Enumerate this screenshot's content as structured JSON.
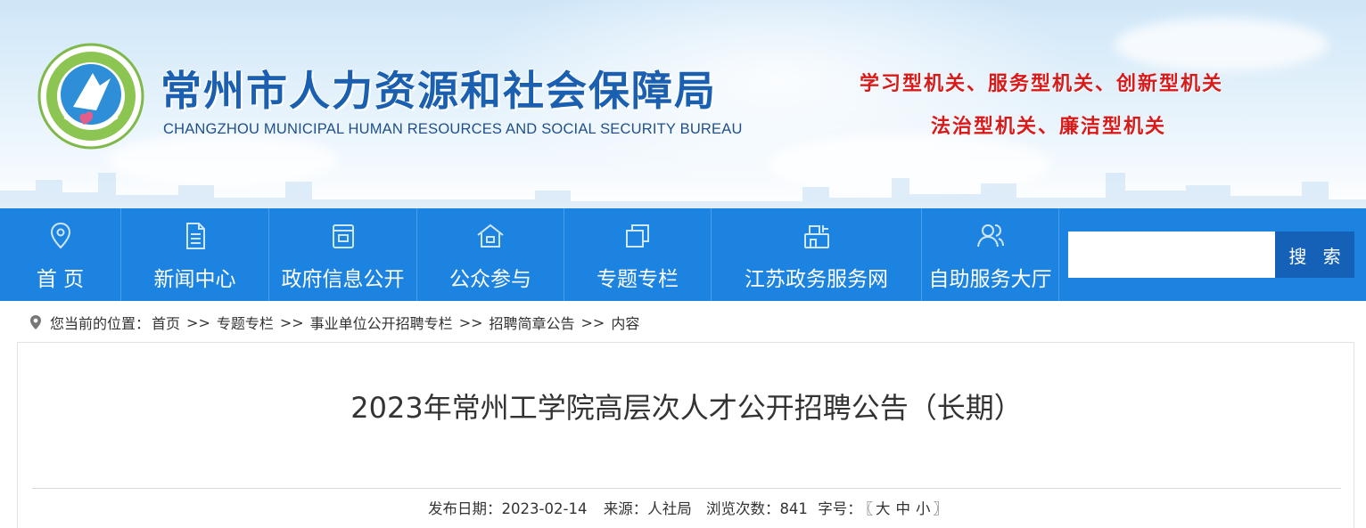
{
  "header": {
    "title": "常州市人力资源和社会保障局",
    "subtitle": "CHANGZHOU MUNICIPAL HUMAN RESOURCES AND SOCIAL SECURITY BUREAU",
    "slogan_line1": "学习型机关、服务型机关、创新型机关",
    "slogan_line2": "法治型机关、廉洁型机关",
    "logo_icon": "bureau-emblem-icon",
    "colors": {
      "title": "#1a5fb0",
      "slogan": "#d81a1a"
    }
  },
  "nav": {
    "background": "#1d83e0",
    "items": [
      {
        "label": "首 页",
        "icon": "location-pin-icon"
      },
      {
        "label": "新闻中心",
        "icon": "document-icon"
      },
      {
        "label": "政府信息公开",
        "icon": "folder-info-icon"
      },
      {
        "label": "公众参与",
        "icon": "house-icon"
      },
      {
        "label": "专题专栏",
        "icon": "layers-icon"
      },
      {
        "label": "江苏政务服务网",
        "icon": "service-building-icon"
      },
      {
        "label": "自助服务大厅",
        "icon": "users-icon"
      }
    ],
    "search": {
      "placeholder": "",
      "value": "",
      "button_label": "搜 索"
    }
  },
  "breadcrumb": {
    "prefix": "您当前的位置：",
    "separator": ">>",
    "items": [
      "首页",
      "专题专栏",
      "事业单位公开招聘专栏",
      "招聘简章公告",
      "内容"
    ]
  },
  "article": {
    "title": "2023年常州工学院高层次人才公开招聘公告（长期）",
    "meta": {
      "date_label": "发布日期：",
      "date": "2023-02-14",
      "source_label": "来源：",
      "source": "人社局",
      "views_label": "浏览次数：",
      "views": "841",
      "font_size_label": "字号：",
      "bracket_open": "〖",
      "size_large": "大",
      "size_medium": "中",
      "size_small": "小",
      "bracket_close": "〗"
    }
  }
}
